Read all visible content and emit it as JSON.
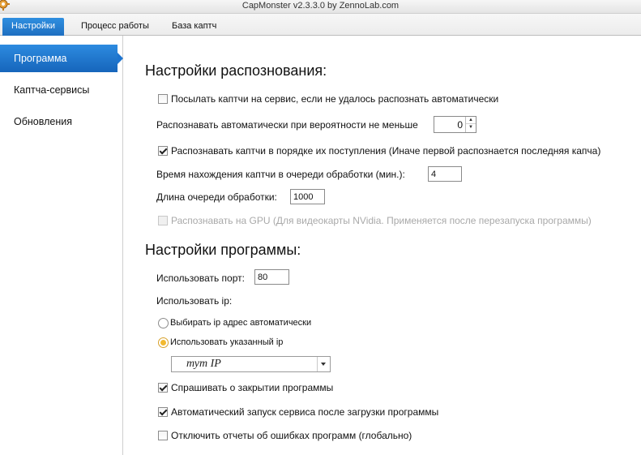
{
  "window": {
    "title": "CapMonster v2.3.3.0 by ZennoLab.com"
  },
  "tabs": [
    {
      "label": "Настройки",
      "active": true
    },
    {
      "label": "Процесс работы",
      "active": false
    },
    {
      "label": "База каптч",
      "active": false
    }
  ],
  "sidebar": {
    "items": [
      {
        "label": "Программа",
        "active": true
      },
      {
        "label": "Каптча-сервисы",
        "active": false
      },
      {
        "label": "Обновления",
        "active": false
      }
    ]
  },
  "recognition": {
    "heading": "Настройки распознования:",
    "send_to_service": {
      "label": "Посылать каптчи на сервис, если не удалось распознать автоматически",
      "checked": false
    },
    "probability": {
      "label": "Распознавать автоматически при вероятности не меньше",
      "value": "0"
    },
    "in_order": {
      "label": "Распознавать каптчи в порядке их поступления (Иначе первой распознается последняя капча)",
      "checked": true
    },
    "queue_time": {
      "label": "Время нахождения каптчи в очереди обработки (мин.):",
      "value": "4"
    },
    "queue_length": {
      "label": "Длина очереди обработки:",
      "value": "1000"
    },
    "gpu": {
      "label": "Распознавать на GPU (Для видеокарты NVidia. Применяется после перезапуска программы)",
      "checked": false,
      "disabled": true
    }
  },
  "program": {
    "heading": "Настройки программы:",
    "port": {
      "label": "Использовать порт:",
      "value": "80"
    },
    "ip_label": "Использовать ip:",
    "ip_auto": {
      "label": "Выбирать ip адрес автоматически",
      "selected": false
    },
    "ip_manual": {
      "label": "Использовать указанный ip",
      "selected": true
    },
    "ip_combo": {
      "value": "тут IP"
    },
    "ask_close": {
      "label": "Спрашивать о закрытии программы",
      "checked": true
    },
    "autostart": {
      "label": "Автоматический запуск сервиса после загрузки программы",
      "checked": true
    },
    "disable_reports": {
      "label": "Отключить отчеты об ошибках программ (глобально)",
      "checked": false
    }
  }
}
